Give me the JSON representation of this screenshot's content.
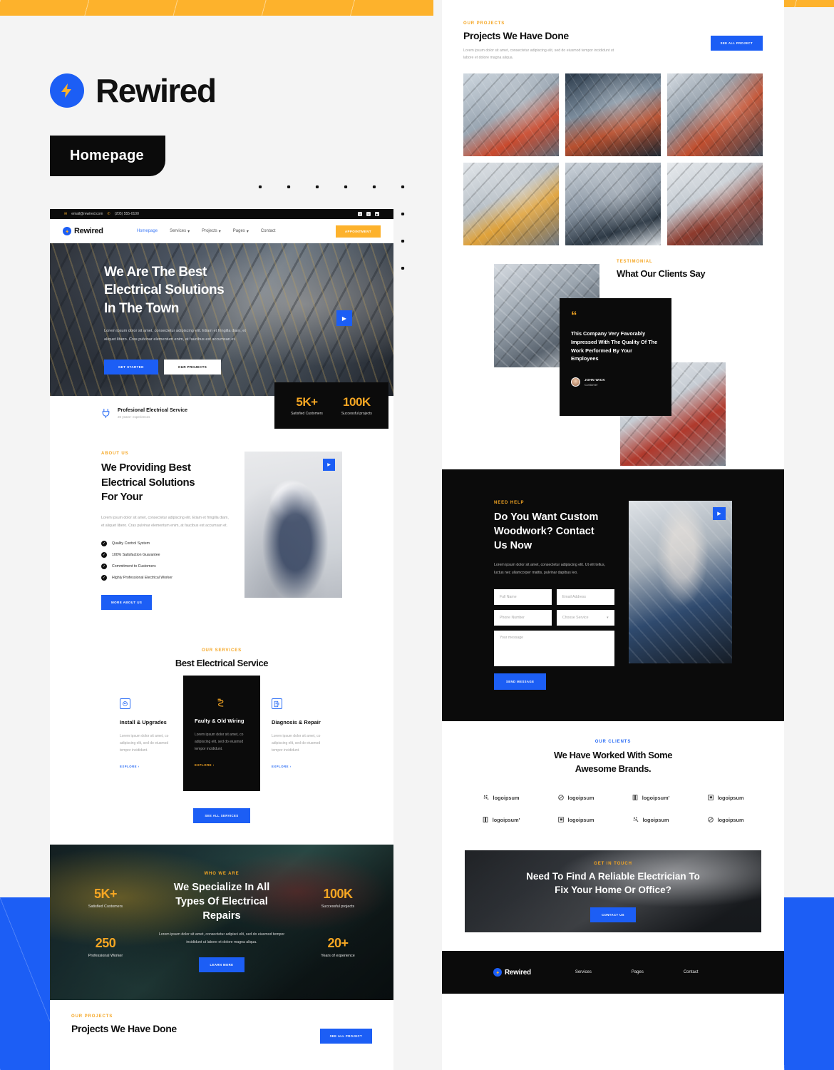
{
  "branding": {
    "name": "Rewired",
    "page_tag": "Homepage",
    "logo_icon": "lightning-bolt-icon",
    "accent_blue": "#1c5ef5",
    "accent_yellow": "#fdb22c"
  },
  "topbar": {
    "email": "email@rewired.com",
    "phone": "(205) 555-0100",
    "socials": [
      "facebook-icon",
      "twitter-icon",
      "youtube-icon"
    ]
  },
  "navbar": {
    "logo": "Rewired",
    "links": [
      {
        "label": "Homepage",
        "active": true,
        "caret": ""
      },
      {
        "label": "Services",
        "active": false,
        "caret": "▾"
      },
      {
        "label": "Projects",
        "active": false,
        "caret": "▾"
      },
      {
        "label": "Pages",
        "active": false,
        "caret": "▾"
      },
      {
        "label": "Contact",
        "active": false,
        "caret": ""
      }
    ],
    "cta": "APPOINTMENT"
  },
  "hero": {
    "title_line1": "We Are The Best",
    "title_line2": "Electrical Solutions",
    "title_line3": "In The Town",
    "paragraph": "Lorem ipsum dolor sit amet, consectetur adipiscing elit. Etiam et fringilla diam, et aliquet libero. Cras pulvinar elementum enim, at faucibus est accumsan et.",
    "btn_primary": "GET STARTED",
    "btn_secondary": "OUR PROJECTS",
    "play_icon": "play-icon"
  },
  "hero_stats": [
    {
      "value": "5K+",
      "label": "Satisfied Customers"
    },
    {
      "value": "100K",
      "label": "Successful projects"
    }
  ],
  "service_bar": {
    "icon": "plug-icon",
    "title": "Profesional Electrical Service",
    "subtitle": "20 years+ experiences"
  },
  "about": {
    "eyebrow": "ABOUT US",
    "title_line1": "We Providing Best",
    "title_line2": "Electrical Solutions",
    "title_line3": "For Your",
    "paragraph": "Lorem ipsum dolor sit amet, consectetur adipiscing elit. Etiam et fringilla diam, et aliquet libero. Cras pulvinar elementum enim, at faucibus est accumsan et.",
    "checklist": [
      "Quality Control System",
      "100% Satisfaction Guarantee",
      "Commitment to Customers",
      "Highly Professional Electrical Worker"
    ],
    "button": "MORE ABOUT US",
    "play_icon": "play-icon"
  },
  "services": {
    "eyebrow": "OUR SERVICES",
    "title": "Best Electrical Service",
    "cards": [
      {
        "icon": "outlet-icon",
        "title": "Install & Upgrades",
        "text": "Lorem ipsum dolor sit amet, co adipiscing elit, sed do eiusmod tempor incididunt.",
        "link": "EXPLORE"
      },
      {
        "icon": "wire-icon",
        "title": "Faulty & Old Wiring",
        "text": "Lorem ipsum dolor sit amet, co adipiscing elit, sed do eiusmod tempor incididunt.",
        "link": "EXPLORE"
      },
      {
        "icon": "meter-icon",
        "title": "Diagnosis & Repair",
        "text": "Lorem ipsum dolor sit amet, co adipiscing elit, sed do eiusmod tempor incididunt.",
        "link": "EXPLORE"
      }
    ],
    "see_all": "SEE ALL SERVICES"
  },
  "band": {
    "eyebrow": "WHO WE ARE",
    "title_line1": "We Specialize In All",
    "title_line2": "Types Of Electrical",
    "title_line3": "Repairs",
    "paragraph": "Lorem ipsum dolor sit amet, consectetur adipisci elit, sed do eiusmod tempor incididunt ut labore et dolore magna aliqua.",
    "button": "LEARN MORE",
    "stats_left": [
      {
        "value": "5K+",
        "label": "Satisfied Customers"
      },
      {
        "value": "250",
        "label": "Professional Worker"
      }
    ],
    "stats_right": [
      {
        "value": "100K",
        "label": "Successful projects"
      },
      {
        "value": "20+",
        "label": "Years of experience"
      }
    ]
  },
  "projects": {
    "eyebrow": "OUR PROJECTS",
    "title": "Projects We Have Done",
    "paragraph": "Lorem ipsum dolor sit amet, consectetur adipiscing elit, sed do eiusmod tempor incididunt ut labore et dolore magna aliqua.",
    "button": "SEE ALL PROJECT"
  },
  "testimonial": {
    "eyebrow": "TESTIMONIAL",
    "title": "What Our Clients Say",
    "quote_mark": "“",
    "quote": "This Company Very Favorably Impressed With The Quality Of The Work Performed By Your Employees",
    "author_name": "JOHN WICK",
    "author_role": "Costumer"
  },
  "contact": {
    "eyebrow": "NEED HELP",
    "title_line1": "Do You Want Custom",
    "title_line2": "Woodwork? Contact",
    "title_line3": "Us Now",
    "paragraph": "Lorem ipsum dolor sit amet, consectetur adipiscing elit. Ut elit tellus, luctus nec ullamcorper mattis, pulvinar dapibus leo.",
    "fields": {
      "full_name": "Full Name",
      "email": "Email Address",
      "phone": "Phone Number",
      "service": "Choose Service",
      "service_caret": "▾",
      "message": "Your message"
    },
    "button": "SEND MESSAGE",
    "play_icon": "play-icon"
  },
  "clients": {
    "eyebrow": "OUR CLIENTS",
    "title_line1": "We Have Worked With Some",
    "title_line2": "Awesome Brands.",
    "logos": [
      {
        "icon": "dots-logo-icon",
        "label": "logoipsum"
      },
      {
        "icon": "circle-slash-logo-icon",
        "label": "logoipsum"
      },
      {
        "icon": "half-square-logo-icon",
        "label": "logoipsum'"
      },
      {
        "icon": "flag-logo-icon",
        "label": "logoipsum"
      },
      {
        "icon": "half-square-logo-icon",
        "label": "logoipsum'"
      },
      {
        "icon": "flag-logo-icon",
        "label": "logoipsum"
      },
      {
        "icon": "dots-logo-icon",
        "label": "logoipsum"
      },
      {
        "icon": "circle-slash-logo-icon",
        "label": "logoipsum"
      }
    ]
  },
  "cta": {
    "eyebrow": "GET IN TOUCH",
    "title_line1": "Need To Find A Reliable Electrician To",
    "title_line2": "Fix Your Home Or Office?",
    "button": "CONTACT US"
  },
  "footer": {
    "logo": "Rewired",
    "links": [
      "Services",
      "Pages",
      "Contact"
    ]
  }
}
